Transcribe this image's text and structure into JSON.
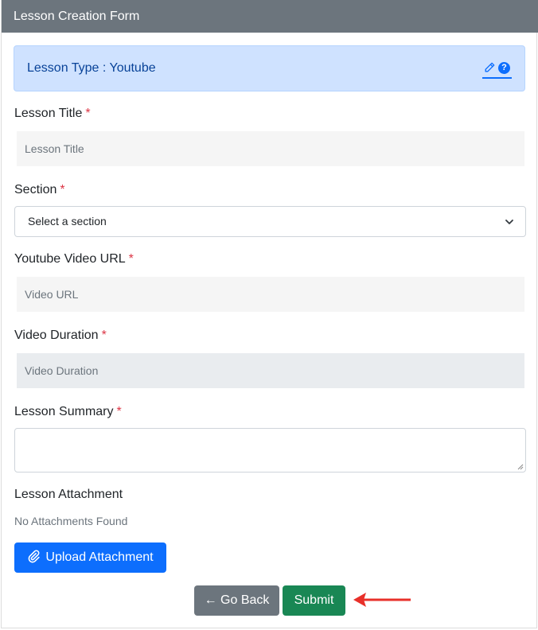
{
  "card": {
    "title": "Lesson Creation Form"
  },
  "alert": {
    "text": "Lesson Type : Youtube",
    "help_glyph": "?"
  },
  "fields": {
    "lesson_title": {
      "label": "Lesson Title",
      "placeholder": "Lesson Title",
      "required": "*"
    },
    "section": {
      "label": "Section",
      "value": "Select a section",
      "required": "*"
    },
    "video_url": {
      "label": "Youtube Video URL",
      "placeholder": "Video URL",
      "required": "*"
    },
    "video_duration": {
      "label": "Video Duration",
      "placeholder": "Video Duration",
      "required": "*"
    },
    "summary": {
      "label": "Lesson Summary",
      "value": "",
      "required": "*"
    },
    "attachment": {
      "label": "Lesson Attachment",
      "empty_text": "No Attachments Found"
    }
  },
  "buttons": {
    "upload": "Upload Attachment",
    "back": "← Go Back",
    "submit": "Submit"
  },
  "icons": {
    "edit": "pencil-icon",
    "help": "question-circle-icon",
    "chevron": "chevron-down-icon",
    "paperclip": "paperclip-icon",
    "annotation": "red-arrow-icon"
  },
  "colors": {
    "header": "#6c757d",
    "alert_bg": "#cfe2ff",
    "primary": "#0d6efd",
    "secondary": "#6c757d",
    "success": "#198754",
    "required": "#dc3545",
    "annotation": "#e8302a"
  }
}
